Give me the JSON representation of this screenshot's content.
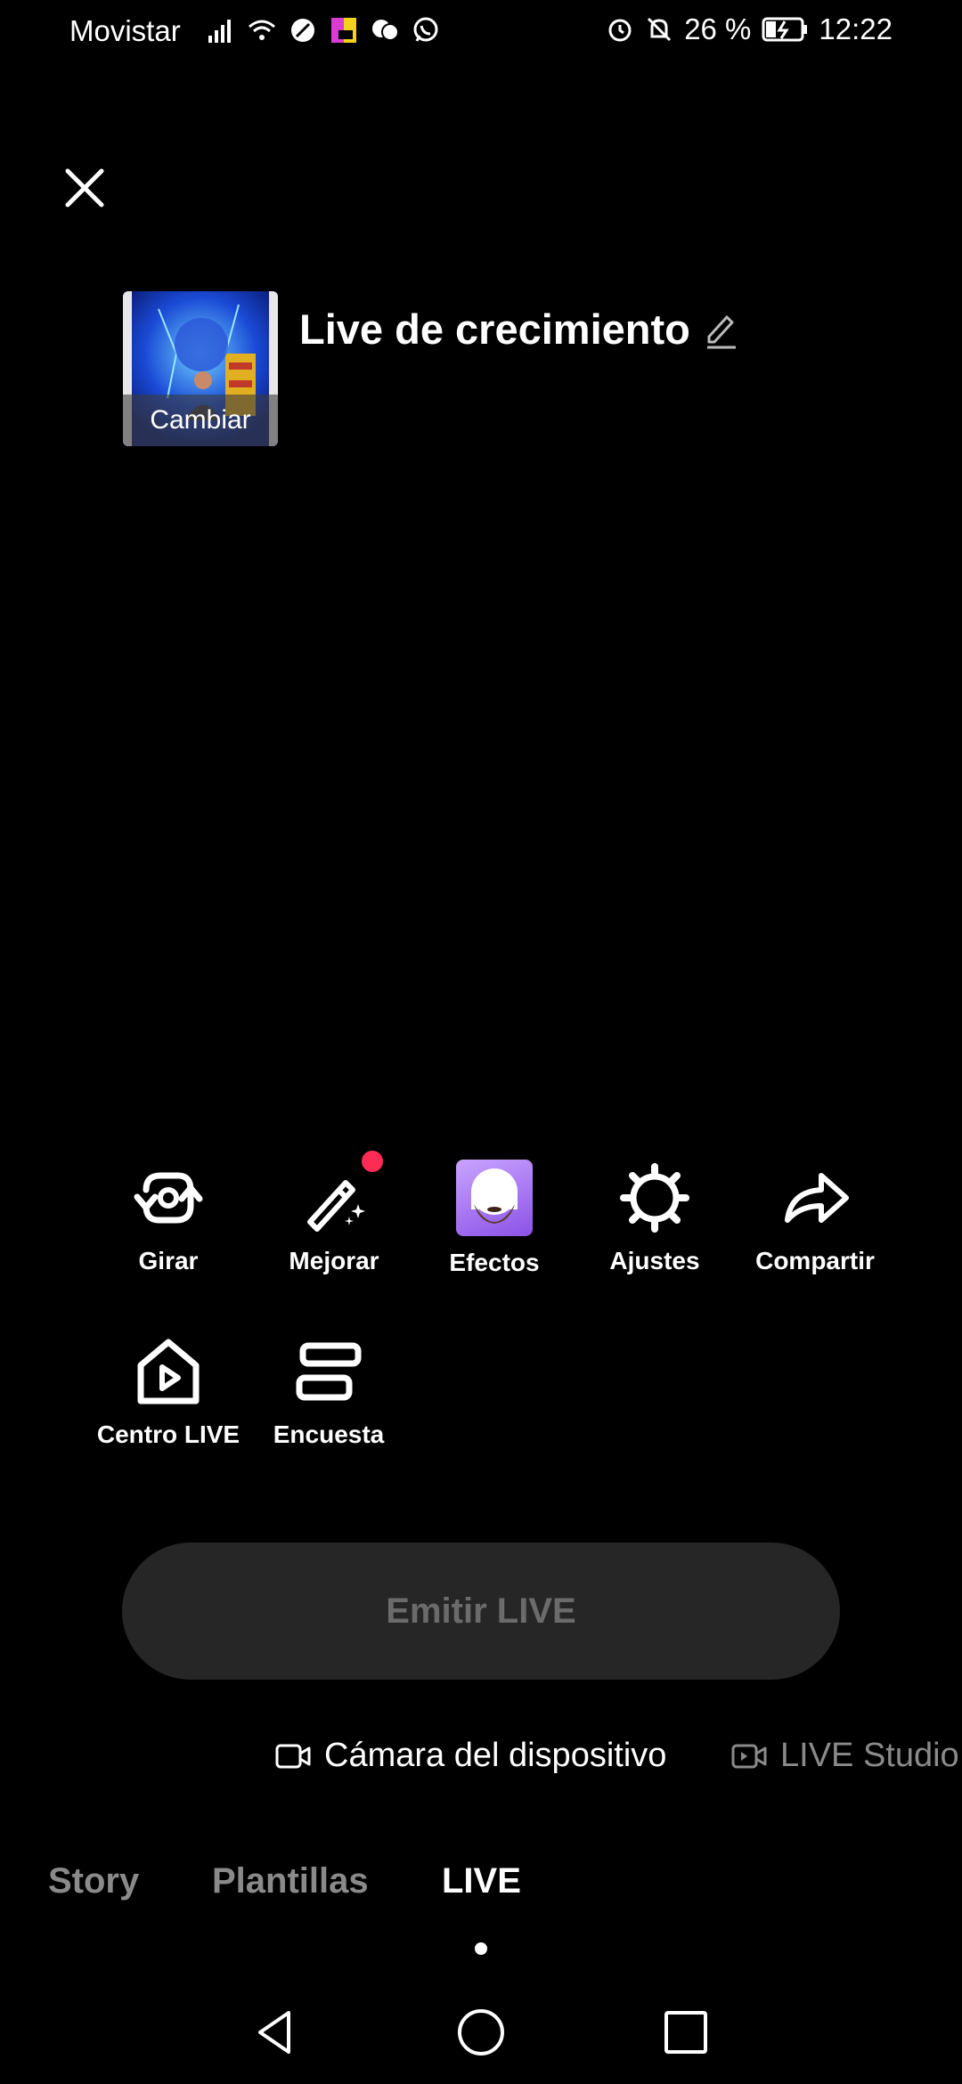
{
  "status_bar": {
    "carrier": "Movistar",
    "battery": "26 %",
    "time": "12:22"
  },
  "live": {
    "cover_label": "Cambiar",
    "title": "Live de crecimiento"
  },
  "tools": [
    {
      "label": "Girar",
      "icon": "flip-camera-icon"
    },
    {
      "label": "Mejorar",
      "icon": "magic-wand-icon",
      "badge": true
    },
    {
      "label": "Efectos",
      "icon": "effects-thumbnail"
    },
    {
      "label": "Ajustes",
      "icon": "gear-icon"
    },
    {
      "label": "Compartir",
      "icon": "share-arrow-icon"
    },
    {
      "label": "Centro LIVE",
      "icon": "live-center-icon"
    },
    {
      "label": "Encuesta",
      "icon": "poll-icon"
    }
  ],
  "emit_button": "Emitir LIVE",
  "sources": {
    "device": "Cámara del dispositivo",
    "studio": "LIVE Studio"
  },
  "modes": {
    "story": "Story",
    "templates": "Plantillas",
    "live": "LIVE"
  },
  "colors": {
    "accent_red": "#fe2c55",
    "button_bg": "#262626",
    "inactive_text": "#8a8a8a"
  }
}
